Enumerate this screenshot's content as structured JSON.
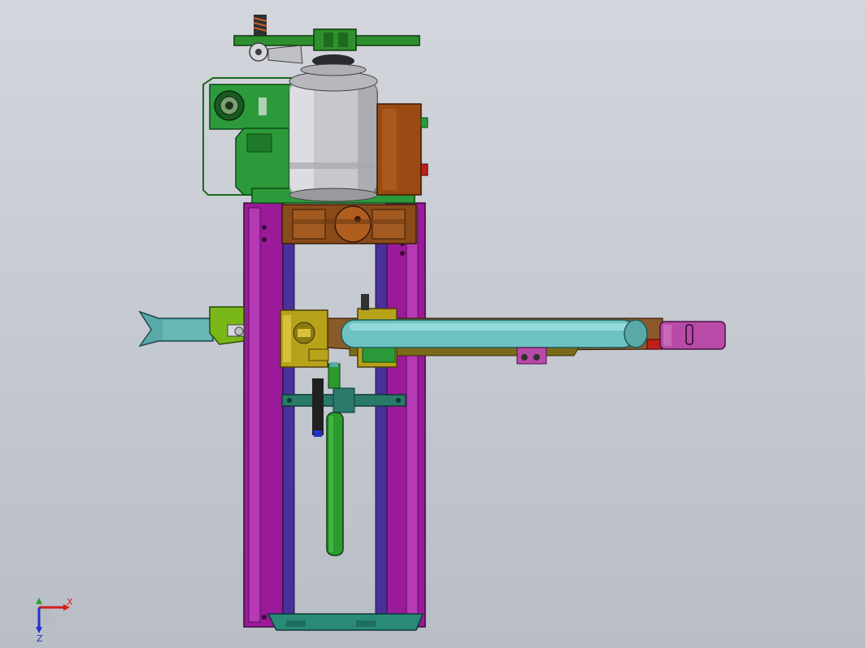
{
  "viewport": {
    "background_top": "#d3d6dc",
    "background_bottom": "#b9bdc6"
  },
  "parts": {
    "top_plate_color": "#2f8f2f",
    "motor_color": "#c8c8cc",
    "bracket_color": "#2c9a3a",
    "gearbox_color": "#9a4a12",
    "frame_color": "#9a1a9a",
    "rail_color": "#4b2f9a",
    "clamp_color": "#b8a21a",
    "arm_color": "#8a5a2a",
    "tube_color": "#6fc2c2",
    "gripper_color": "#5aa9a9",
    "cylinder_color": "#2d9a2d",
    "end_block_color": "#b84aa8",
    "base_color": "#2a8a7a"
  },
  "triad": {
    "x_label": "X",
    "z_label": "Z",
    "x_color": "#d0201a",
    "y_color": "#2aa02a",
    "z_color": "#2033c8"
  }
}
